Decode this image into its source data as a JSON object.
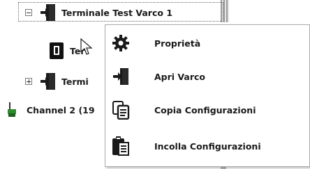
{
  "tree": {
    "items": [
      {
        "label": "Terminale Test Varco 1",
        "expander": "minus"
      },
      {
        "label": "Ter"
      },
      {
        "label": "Termi",
        "expander": "plus"
      },
      {
        "label": "Channel 2 (19"
      }
    ]
  },
  "context_menu": {
    "items": [
      {
        "label": "Proprietà",
        "icon": "gear-icon"
      },
      {
        "label": "Apri Varco",
        "icon": "door-enter-icon"
      },
      {
        "label": "Copia Configurazioni",
        "icon": "copy-icon"
      },
      {
        "label": "Incolla Configurazioni",
        "icon": "paste-icon"
      }
    ]
  },
  "colors": {
    "icon_dark": "#1a1a1a",
    "menu_border": "#a9a9a9",
    "channel_green": "#2e8b2e"
  }
}
